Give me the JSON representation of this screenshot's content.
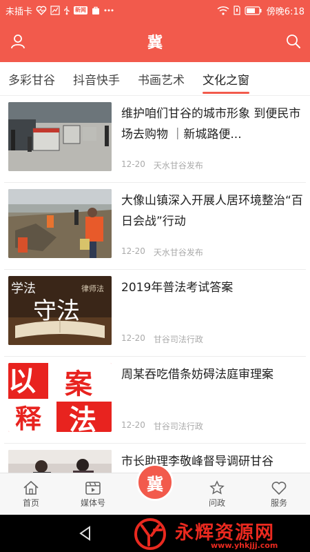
{
  "status_bar": {
    "carrier": "未插卡",
    "time": "傍晚6:18",
    "app_badge": "新闻"
  },
  "header": {
    "title": "冀"
  },
  "tabs": [
    {
      "label": "多彩甘谷",
      "active": false
    },
    {
      "label": "抖音快手",
      "active": false
    },
    {
      "label": "书画艺术",
      "active": false
    },
    {
      "label": "文化之窗",
      "active": true
    }
  ],
  "feed": [
    {
      "title": "维护咱们甘谷的城市形象 到便民市场去购物 ｜新城路便...",
      "date": "12-20",
      "source": "天水甘谷发布",
      "thumb": "market-photo"
    },
    {
      "title": "大像山镇深入开展人居环境整治“百日会战”行动",
      "date": "12-20",
      "source": "天水甘谷发布",
      "thumb": "cleanup-photo"
    },
    {
      "title": "2019年普法考试答案",
      "date": "12-20",
      "source": "甘谷司法行政",
      "thumb": "law-book-photo",
      "thumb_text": {
        "a": "学法",
        "b": "守法",
        "c": "律师法"
      }
    },
    {
      "title": "周某吞吃借条妨碍法庭审理案",
      "date": "12-20",
      "source": "甘谷司法行政",
      "thumb": "case-poster",
      "thumb_text": {
        "a": "以",
        "b": "案",
        "c": "释",
        "d": "法"
      }
    },
    {
      "title": "市长助理李敬峰督导调研甘谷",
      "date": "",
      "source": "",
      "thumb": "meeting-photo"
    }
  ],
  "bottom_nav": [
    {
      "label": "首页",
      "icon": "home-icon"
    },
    {
      "label": "媒体号",
      "icon": "media-icon"
    },
    {
      "label": "冀",
      "icon": "center-logo"
    },
    {
      "label": "问政",
      "icon": "star-icon"
    },
    {
      "label": "服务",
      "icon": "heart-icon"
    }
  ],
  "watermark": {
    "title": "永辉资源网",
    "url": "www.yhkjjj.com"
  },
  "colors": {
    "brand": "#f25a4c",
    "watermark": "#e9291f"
  }
}
